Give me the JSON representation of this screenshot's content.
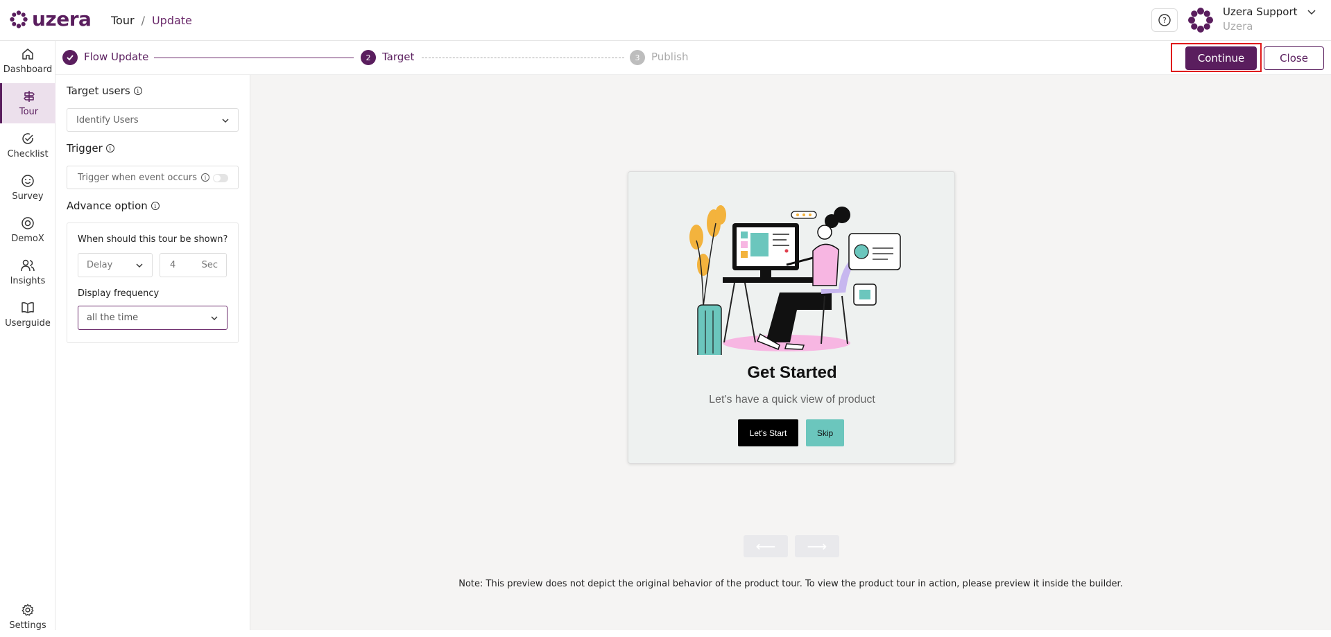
{
  "app": {
    "brand": "uzera"
  },
  "breadcrumb": {
    "root": "Tour",
    "separator": "/",
    "current": "Update"
  },
  "user": {
    "name": "Uzera Support",
    "org": "Uzera"
  },
  "sidebar": {
    "items": [
      {
        "label": "Dashboard",
        "icon": "home-icon"
      },
      {
        "label": "Tour",
        "icon": "signpost-icon",
        "active": true
      },
      {
        "label": "Checklist",
        "icon": "check-circle-icon"
      },
      {
        "label": "Survey",
        "icon": "smiley-icon"
      },
      {
        "label": "DemoX",
        "icon": "target-icon"
      },
      {
        "label": "Insights",
        "icon": "users-icon"
      },
      {
        "label": "Userguide",
        "icon": "book-icon"
      }
    ],
    "settings_label": "Settings"
  },
  "stepper": {
    "steps": [
      {
        "num": "1",
        "label": "Flow Update",
        "state": "done"
      },
      {
        "num": "2",
        "label": "Target",
        "state": "current"
      },
      {
        "num": "3",
        "label": "Publish",
        "state": "pending"
      }
    ]
  },
  "actions": {
    "continue_label": "Continue",
    "close_label": "Close"
  },
  "panel": {
    "target_users_title": "Target users",
    "target_users_value": "Identify Users",
    "trigger_title": "Trigger",
    "trigger_label": "Trigger when event occurs",
    "advance_title": "Advance option",
    "when_question": "When should this tour be shown?",
    "delay_value": "Delay",
    "delay_number": "4",
    "delay_unit": "Sec",
    "frequency_label": "Display frequency",
    "frequency_value": "all the time"
  },
  "preview": {
    "title": "Get Started",
    "subtitle": "Let's have a quick view of product",
    "start_label": "Let's Start",
    "skip_label": "Skip",
    "prev_arrow": "⟵",
    "next_arrow": "⟶",
    "note": "Note: This preview does not depict the original behavior of the product tour. To view the product tour in action, please preview it inside the builder."
  },
  "colors": {
    "brand": "#5a1e5e",
    "highlight": "#e0191b",
    "teal": "#6bc6bd"
  }
}
